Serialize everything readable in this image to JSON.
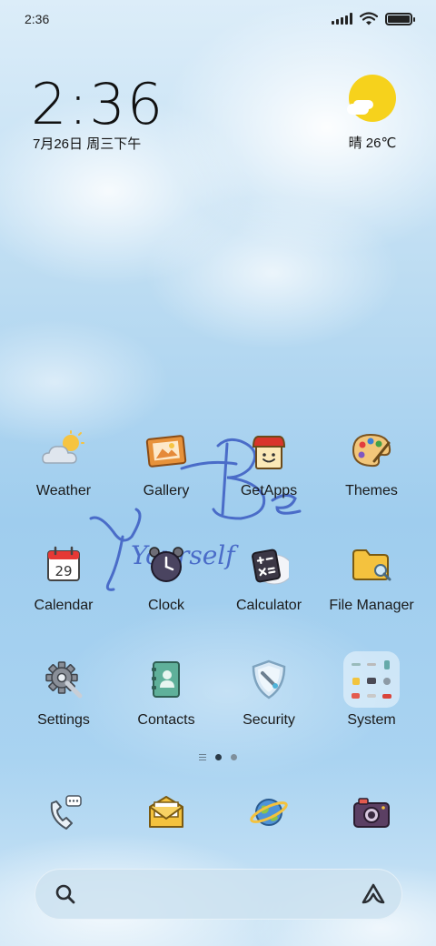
{
  "status_bar": {
    "time": "2:36"
  },
  "clock_widget": {
    "time": "2:36",
    "date": "7月26日 周三下午"
  },
  "weather_widget": {
    "text": "晴 26℃"
  },
  "apps": [
    {
      "name": "weather",
      "label": "Weather",
      "icon": "weather-icon"
    },
    {
      "name": "gallery",
      "label": "Gallery",
      "icon": "gallery-icon"
    },
    {
      "name": "getapps",
      "label": "GetApps",
      "icon": "getapps-icon"
    },
    {
      "name": "themes",
      "label": "Themes",
      "icon": "themes-icon"
    },
    {
      "name": "calendar",
      "label": "Calendar",
      "icon": "calendar-icon",
      "day": "29"
    },
    {
      "name": "clock",
      "label": "Clock",
      "icon": "clock-icon"
    },
    {
      "name": "calculator",
      "label": "Calculator",
      "icon": "calculator-icon"
    },
    {
      "name": "file-manager",
      "label": "File Manager",
      "icon": "file-manager-icon"
    },
    {
      "name": "settings",
      "label": "Settings",
      "icon": "settings-icon"
    },
    {
      "name": "contacts",
      "label": "Contacts",
      "icon": "contacts-icon"
    },
    {
      "name": "security",
      "label": "Security",
      "icon": "security-icon"
    },
    {
      "name": "system",
      "label": "System",
      "icon": "folder-icon"
    }
  ],
  "wallpaper_text": {
    "line1": "Be",
    "line2": "Yourself"
  },
  "dock": [
    {
      "name": "phone",
      "icon": "phone-icon"
    },
    {
      "name": "messages",
      "icon": "messages-icon"
    },
    {
      "name": "browser",
      "icon": "browser-icon"
    },
    {
      "name": "camera",
      "icon": "camera-icon"
    }
  ],
  "pager": {
    "pages": 2,
    "current": 1
  },
  "colors": {
    "accent_sun": "#f6d21c",
    "handwriting": "#4a6cc8"
  }
}
